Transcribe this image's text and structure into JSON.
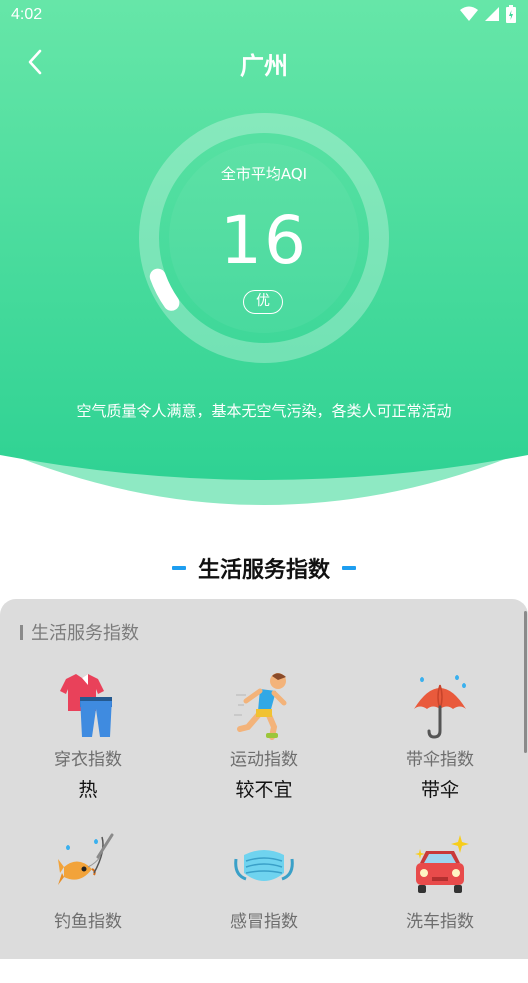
{
  "status_bar": {
    "time": "4:02"
  },
  "header": {
    "title": "广州",
    "aqi_label": "全市平均AQI",
    "aqi_value": "16",
    "aqi_level": "优",
    "aqi_progress_fraction": 0.05,
    "description": "空气质量令人满意，基本无空气污染，各类人可正常活动",
    "colors": {
      "gradient_top": "#66e6a8",
      "gradient_bottom": "#2ed293",
      "accent": "#1e9ef0"
    }
  },
  "section": {
    "title": "生活服务指数"
  },
  "panel": {
    "title": "生活服务指数",
    "items": [
      {
        "name": "穿衣指数",
        "value": "热",
        "icon": "clothes-icon"
      },
      {
        "name": "运动指数",
        "value": "较不宜",
        "icon": "running-icon"
      },
      {
        "name": "带伞指数",
        "value": "带伞",
        "icon": "umbrella-icon"
      },
      {
        "name": "钓鱼指数",
        "value": "",
        "icon": "fishing-icon"
      },
      {
        "name": "感冒指数",
        "value": "",
        "icon": "mask-icon"
      },
      {
        "name": "洗车指数",
        "value": "",
        "icon": "car-wash-icon"
      }
    ]
  }
}
